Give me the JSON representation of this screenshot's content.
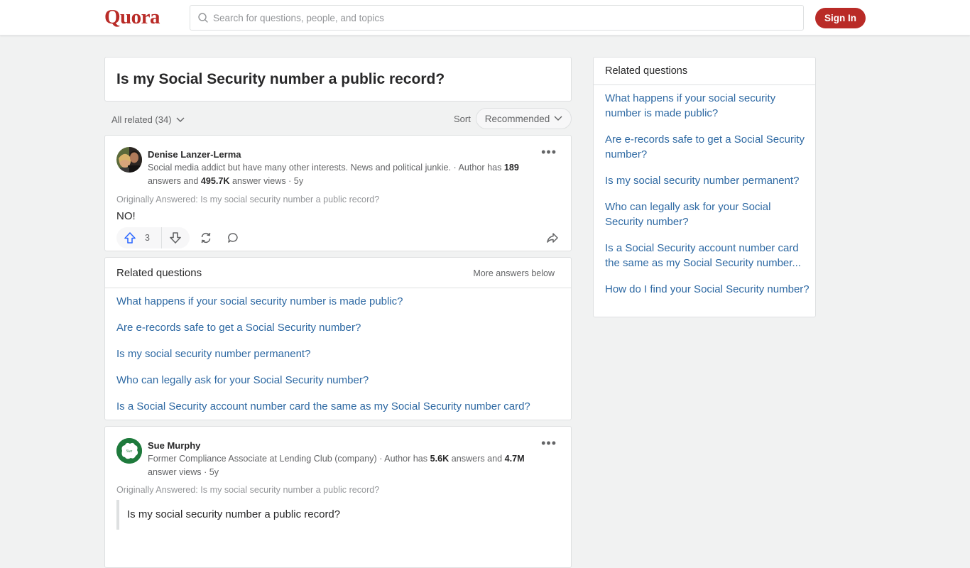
{
  "header": {
    "logo": "Quora",
    "search_placeholder": "Search for questions, people, and topics",
    "signin_label": "Sign In"
  },
  "question": {
    "title": "Is my Social Security number a public record?"
  },
  "filter": {
    "all_related": "All related (34)",
    "sort_label": "Sort",
    "sort_value": "Recommended"
  },
  "answers": [
    {
      "author": "Denise Lanzer-Lerma",
      "cred_text": "Social media addict but have many other interests. News and political junkie. · Author has ",
      "answers_count": "189",
      "cred_mid": " answers and ",
      "views_count": "495.7K",
      "cred_end": " answer views · 5y",
      "originally_answered": "Originally Answered: Is my social security number a public record?",
      "body": "NO!",
      "upvotes": "3"
    },
    {
      "author": "Sue Murphy",
      "cred_text": "Former Compliance Associate at Lending Club (company) · Author has ",
      "answers_count": "5.6K",
      "cred_mid": " answers and ",
      "views_count": "4.7M",
      "cred_end": " answer views · 5y",
      "originally_answered": "Originally Answered: Is my social security number a public record?",
      "quote": "Is my social security number a public record?",
      "avatar_text": "Sue"
    }
  ],
  "related_inline": {
    "title": "Related questions",
    "more": "More answers below",
    "items": [
      "What happens if your social security number is made public?",
      "Are e-records safe to get a Social Security number?",
      "Is my social security number permanent?",
      "Who can legally ask for your Social Security number?",
      "Is a Social Security account number card the same as my Social Security number card?"
    ]
  },
  "sidebar": {
    "title": "Related questions",
    "items": [
      "What happens if your social security number is made public?",
      "Are e-records safe to get a Social Security number?",
      "Is my social security number permanent?",
      "Who can legally ask for your Social Security number?",
      "Is a Social Security account number card the same as my Social Security number...",
      "How do I find your Social Security number?"
    ]
  },
  "colors": {
    "brand": "#b92b27",
    "link": "#2e69a3",
    "upvote": "#2e69ff"
  }
}
